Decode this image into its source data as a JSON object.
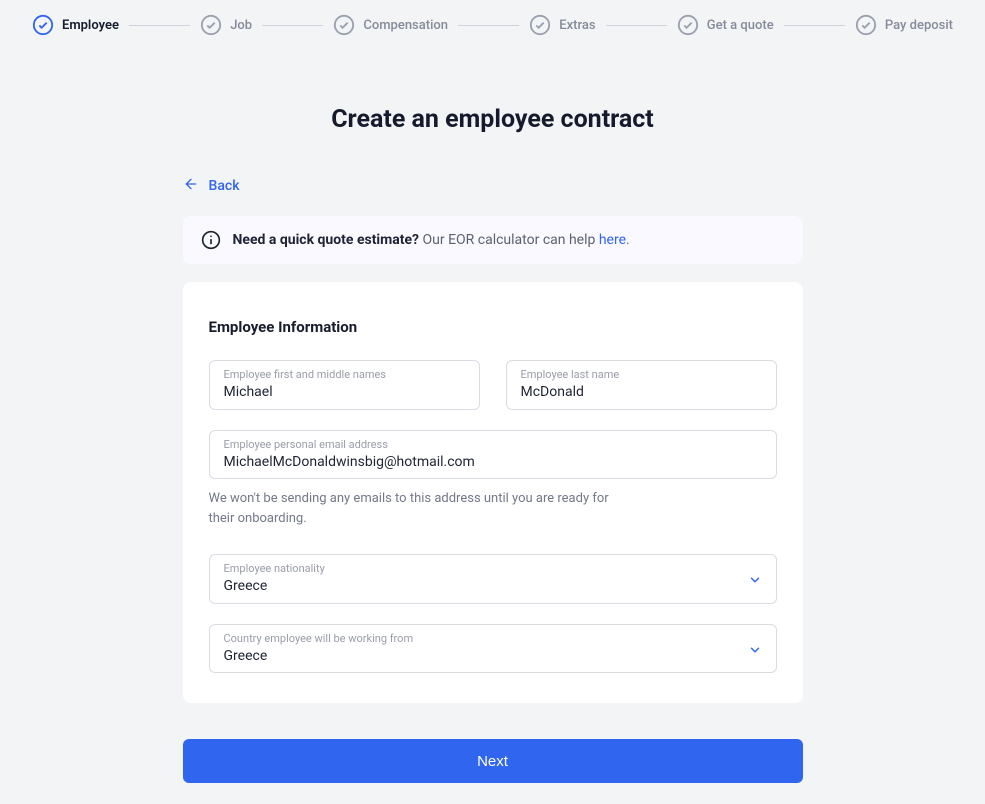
{
  "stepper": {
    "steps": [
      {
        "label": "Employee",
        "active": true
      },
      {
        "label": "Job",
        "active": false
      },
      {
        "label": "Compensation",
        "active": false
      },
      {
        "label": "Extras",
        "active": false
      },
      {
        "label": "Get a quote",
        "active": false
      },
      {
        "label": "Pay deposit",
        "active": false
      }
    ]
  },
  "page_title": "Create an employee contract",
  "back_label": "Back",
  "banner": {
    "strong": "Need a quick quote estimate?",
    "text": " Our EOR calculator can help ",
    "link": "here",
    "suffix": "."
  },
  "section_heading": "Employee Information",
  "form": {
    "first_name": {
      "label": "Employee first and middle names",
      "value": "Michael"
    },
    "last_name": {
      "label": "Employee last name",
      "value": "McDonald"
    },
    "email": {
      "label": "Employee personal email address",
      "value": "MichaelMcDonaldwinsbig@hotmail.com",
      "helper": "We won't be sending any emails to this address until you are ready for their onboarding."
    },
    "nationality": {
      "label": "Employee nationality",
      "value": "Greece"
    },
    "work_country": {
      "label": "Country employee will be working from",
      "value": "Greece"
    }
  },
  "next_button": "Next",
  "colors": {
    "accent": "#3065f0",
    "stepper_inactive": "#9aa0ae"
  }
}
